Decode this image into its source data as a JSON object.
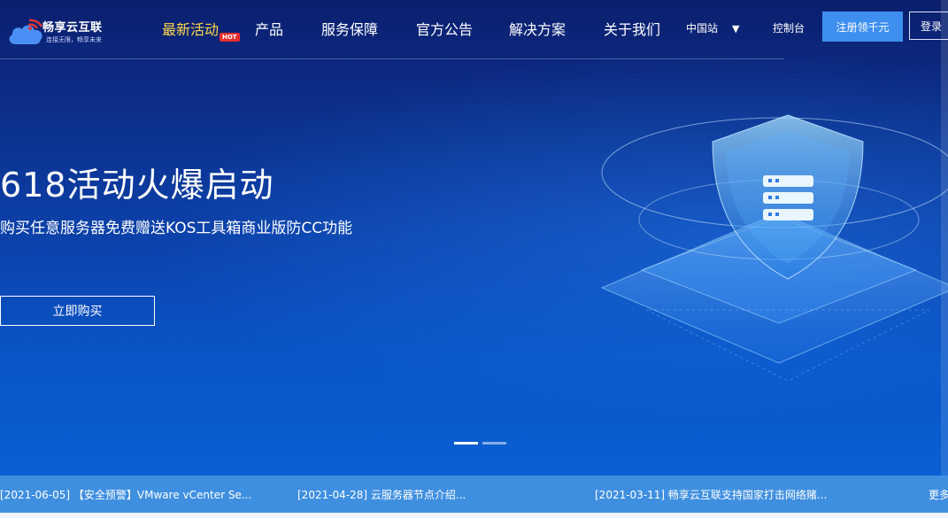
{
  "brand": {
    "name": "畅享云互联",
    "slogan": "连接无限，畅享未来"
  },
  "nav": {
    "items": [
      {
        "label": "最新活动",
        "badge": "HOT"
      },
      {
        "label": "产品"
      },
      {
        "label": "服务保障"
      },
      {
        "label": "官方公告"
      },
      {
        "label": "解决方案"
      },
      {
        "label": "关于我们"
      }
    ],
    "region": "中国站",
    "region_caret": "▼",
    "console": "控制台",
    "register": "注册领千元",
    "login": "登录"
  },
  "hero": {
    "title": "618活动火爆启动",
    "subtitle": "购买任意服务器免费赠送KOS工具箱商业版防CC功能",
    "cta": "立即购买",
    "slides": 2,
    "active_slide": 1
  },
  "news": {
    "items": [
      "[2021-06-05] 【安全预警】VMware vCenter Se...",
      "[2021-04-28] 云服务器节点介绍...",
      "[2021-03-11] 畅享云互联支持国家打击网络赌..."
    ],
    "more": "更多"
  },
  "colors": {
    "accent": "#3e8ff0",
    "hot_text": "#ffd84a",
    "hot_badge": "#e52f2f",
    "news_bar": "#3f8fe0"
  },
  "icons": {
    "logo": "cloud-wifi-icon",
    "region_caret": "caret-down-icon",
    "hero_art": "shield-server-icon"
  }
}
